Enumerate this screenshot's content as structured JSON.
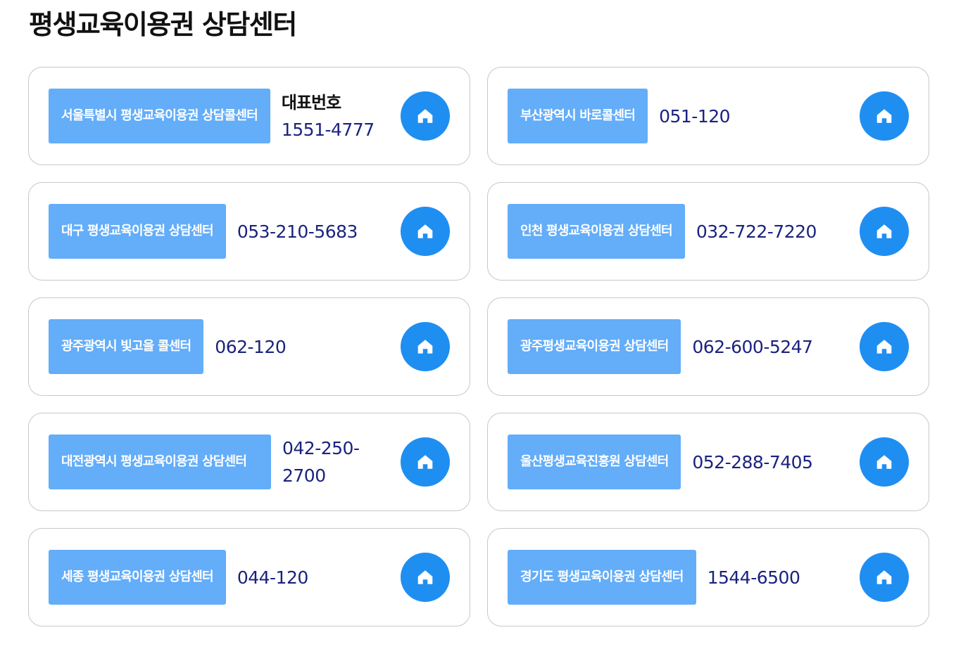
{
  "page": {
    "title": "평생교육이용권 상담센터"
  },
  "centers": [
    {
      "name": "서울특별시 평생교육이용권 상담콜센터",
      "caption": "대표번호",
      "phone": "1551-4777"
    },
    {
      "name": "부산광역시 바로콜센터",
      "caption": "",
      "phone": "051-120"
    },
    {
      "name": "대구 평생교육이용권 상담센터",
      "caption": "",
      "phone": "053-210-5683"
    },
    {
      "name": "인천 평생교육이용권 상담센터",
      "caption": "",
      "phone": "032-722-7220"
    },
    {
      "name": "광주광역시 빛고을 콜센터",
      "caption": "",
      "phone": "062-120"
    },
    {
      "name": "광주평생교육이용권 상담센터",
      "caption": "",
      "phone": "062-600-5247"
    },
    {
      "name": "대전광역시 평생교육이용권 상담센터",
      "caption": "",
      "phone": "042-250-2700"
    },
    {
      "name": "울산평생교육진흥원 상담센터",
      "caption": "",
      "phone": "052-288-7405"
    },
    {
      "name": "세종 평생교육이용권 상담센터",
      "caption": "",
      "phone": "044-120"
    },
    {
      "name": "경기도 평생교육이용권 상담센터",
      "caption": "",
      "phone": "1544-6500"
    }
  ],
  "icons": {
    "homepage_link": "home-icon"
  },
  "colors": {
    "name_badge_bg": "#63adf9",
    "phone_text": "#1a237e",
    "home_button_bg": "#1f8ef1",
    "card_border": "#c8c8c8"
  }
}
